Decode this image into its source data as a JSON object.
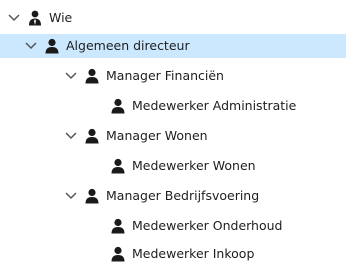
{
  "tree": {
    "root": {
      "label": "Wie",
      "icon": "user-tie-icon",
      "expanded": true
    },
    "director": {
      "label": "Algemeen directeur",
      "icon": "user-icon",
      "expanded": true,
      "selected": true
    },
    "manager_finance": {
      "label": "Manager Financiën",
      "icon": "user-icon",
      "expanded": true
    },
    "employee_admin": {
      "label": "Medewerker Administratie",
      "icon": "user-icon"
    },
    "manager_housing": {
      "label": "Manager Wonen",
      "icon": "user-icon",
      "expanded": true
    },
    "employee_housing": {
      "label": "Medewerker Wonen",
      "icon": "user-icon"
    },
    "manager_operations": {
      "label": "Manager Bedrijfsvoering",
      "icon": "user-icon",
      "expanded": true
    },
    "employee_maintenance": {
      "label": "Medewerker Onderhoud",
      "icon": "user-icon"
    },
    "employee_purchasing": {
      "label": "Medewerker Inkoop",
      "icon": "user-icon"
    }
  },
  "colors": {
    "selection": "#cce8ff",
    "icon": "#1a1a1a",
    "chevron": "#555555"
  }
}
